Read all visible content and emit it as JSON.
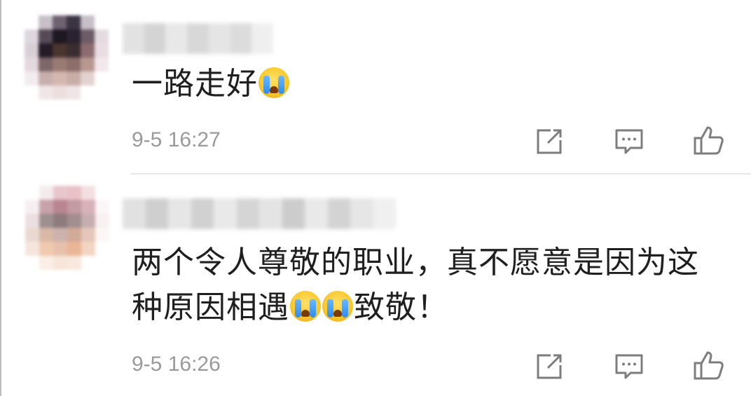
{
  "comments": [
    {
      "text_parts": [
        "一路走好"
      ],
      "emoji_count": 1,
      "trailing_text": "",
      "time": "9-5 16:27",
      "icons": [
        "share-icon",
        "comment-icon",
        "like-icon"
      ]
    },
    {
      "text_parts": [
        "两个令人尊敬的职业，真不愿意是因为这种原因相遇"
      ],
      "emoji_count": 2,
      "trailing_text": "致敬！",
      "time": "9-5 16:26",
      "icons": [
        "share-icon",
        "comment-icon",
        "like-icon"
      ]
    }
  ],
  "colors": {
    "text": "#1f1f1f",
    "time": "#9a9a9a",
    "icon": "#7d7d7d",
    "divider": "#e8e8e8"
  }
}
